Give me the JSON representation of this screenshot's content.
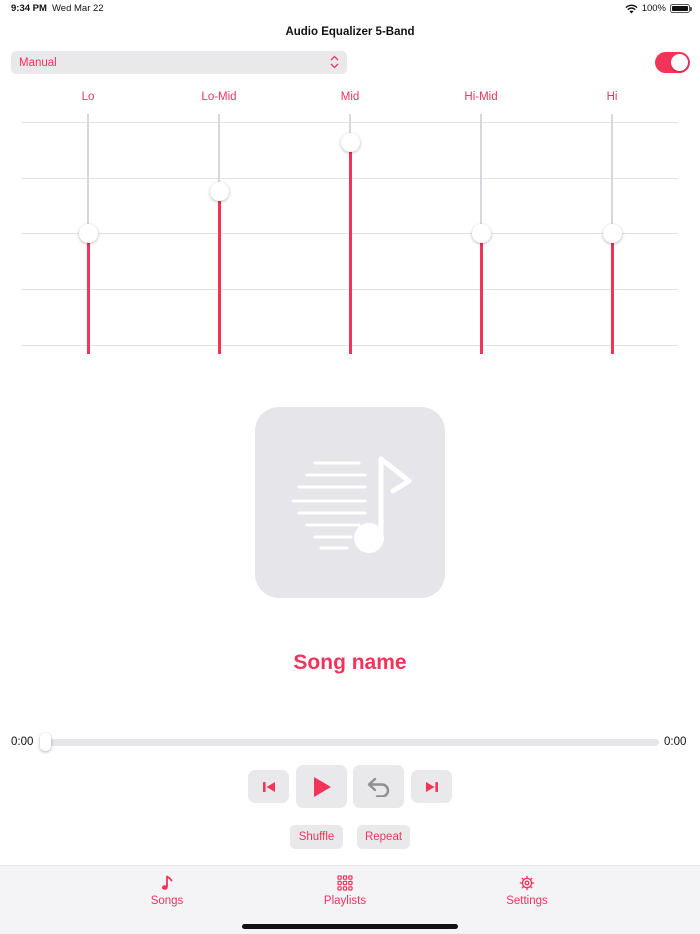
{
  "status_bar": {
    "time": "9:34 PM",
    "date": "Wed Mar 22",
    "battery": "100%",
    "battery_level": 1.0
  },
  "nav": {
    "title": "Audio Equalizer 5-Band"
  },
  "preset": {
    "value": "Manual"
  },
  "equalizer_enabled": true,
  "bands": [
    {
      "label": "Lo",
      "level": 0.5
    },
    {
      "label": "Lo-Mid",
      "level": 0.69
    },
    {
      "label": "Mid",
      "level": 0.91
    },
    {
      "label": "Hi-Mid",
      "level": 0.5
    },
    {
      "label": "Hi",
      "level": 0.5
    }
  ],
  "player": {
    "song_name": "Song name",
    "elapsed": "0:00",
    "duration": "0:00",
    "progress": 0.0,
    "shuffle_label": "Shuffle",
    "repeat_label": "Repeat"
  },
  "tabs": [
    {
      "label": "Songs",
      "icon": "music-note-icon"
    },
    {
      "label": "Playlists",
      "icon": "grid-icon"
    },
    {
      "label": "Settings",
      "icon": "gear-icon"
    }
  ],
  "colors": {
    "accent": "#f2335a",
    "control_bg": "#e9e9eb",
    "artwork_bg": "#e5e5ea"
  }
}
